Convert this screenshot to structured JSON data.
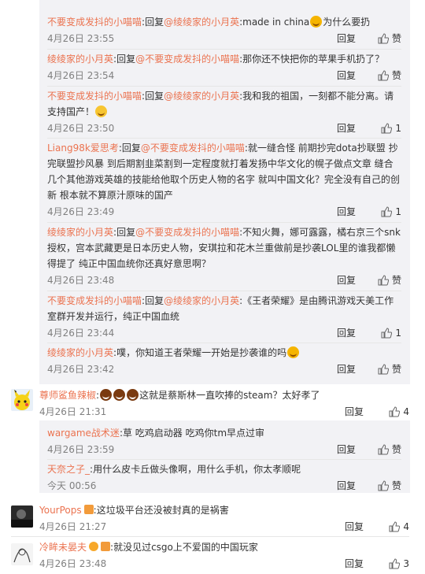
{
  "ui": {
    "reply_label": "回复",
    "like_label": "赞",
    "reply_word": "回复",
    "at": "@",
    "colon": ":"
  },
  "thread_replies": [
    {
      "author": "不要变成发抖的小喵喵",
      "target": "绫绫家的小月英",
      "text_before": "made in china",
      "text_after": "为什么要扔",
      "emoji": "laugh",
      "time": "4月26日 23:55",
      "likes": "赞"
    },
    {
      "author": "绫绫家的小月英",
      "target": "不要变成发抖的小喵喵",
      "text_before": "那你还不快把你的苹果手机扔了？",
      "text_after": "",
      "emoji": "",
      "time": "4月26日 23:54",
      "likes": "赞"
    },
    {
      "author": "不要变成发抖的小喵喵",
      "target": "绫绫家的小月英",
      "text_before": "我和我的祖国，一刻都不能分离。请支持国产！",
      "text_after": "",
      "emoji": "smile",
      "time": "4月26日 23:50",
      "likes": "1"
    },
    {
      "author": "Liang98k爱思考",
      "target": "不要变成发抖的小喵喵",
      "text_before": "就一缝合怪 前期抄完dota抄联盟 抄完联盟抄风暴 到后期割韭菜割到一定程度就打着发扬中华文化的幌子做点文章 缝合几个其他游戏英雄的技能给他取个历史人物的名字 就叫中国文化？完全没有自己的创新 根本就不算原汁原味的国产",
      "text_after": "",
      "emoji": "",
      "time": "4月26日 23:49",
      "likes": "1"
    },
    {
      "author": "绫绫家的小月英",
      "target": "不要变成发抖的小喵喵",
      "text_before": "不知火舞，娜可露露，橘右京三个snk授权，宫本武藏更是日本历史人物，安琪拉和花木兰重做前是抄袭LOL里的谁我都懒得提了 纯正中国血统你还真好意思啊？",
      "text_after": "",
      "emoji": "",
      "time": "4月26日 23:48",
      "likes": "赞"
    },
    {
      "author": "不要变成发抖的小喵喵",
      "target": "绫绫家的小月英",
      "text_before": "《王者荣耀》是由腾讯游戏天美工作室群开发并运行，纯正中国血统",
      "text_after": "",
      "emoji": "",
      "time": "4月26日 23:44",
      "likes": "1"
    },
    {
      "author": "绫绫家的小月英",
      "target": "",
      "text_before": "噗，你知道王者荣耀一开始是抄袭谁的吗",
      "text_after": "",
      "emoji": "laugh",
      "time": "4月26日 23:42",
      "likes": "赞"
    }
  ],
  "comment1": {
    "author": "尊师鲨鱼辣椒",
    "text": "这就是蔡斯林一直吹捧的steam？太好孝了",
    "time": "4月26日 21:31",
    "likes": "4"
  },
  "comment1_replies": [
    {
      "author": "wargame战术迷",
      "text": "草 吃鸡启动器 吃鸡你tm早点过审",
      "time": "4月26日 23:59",
      "likes": "赞"
    },
    {
      "author": "天奈之子_",
      "text": "用什么皮卡丘做头像啊，用什么手机，你太孝顺呢",
      "time": "今天 00:56",
      "likes": "赞"
    }
  ],
  "comment2": {
    "author": "YourPops",
    "text": "这垃圾平台还没被封真的是祸害",
    "time": "4月26日 21:27",
    "likes": "4"
  },
  "comment3": {
    "author": "冷眸未晏夫",
    "text": "就没见过csgo上不爱国的中国玩家",
    "time": "4月26日 23:48",
    "likes": "3"
  },
  "colors": {
    "username": "#eb7350",
    "thread_bg": "#f2f2f5",
    "meta": "#808080"
  },
  "icons": [
    "thumb-up-icon",
    "emoji-laugh-icon",
    "emoji-smile-icon",
    "badge-icon"
  ]
}
